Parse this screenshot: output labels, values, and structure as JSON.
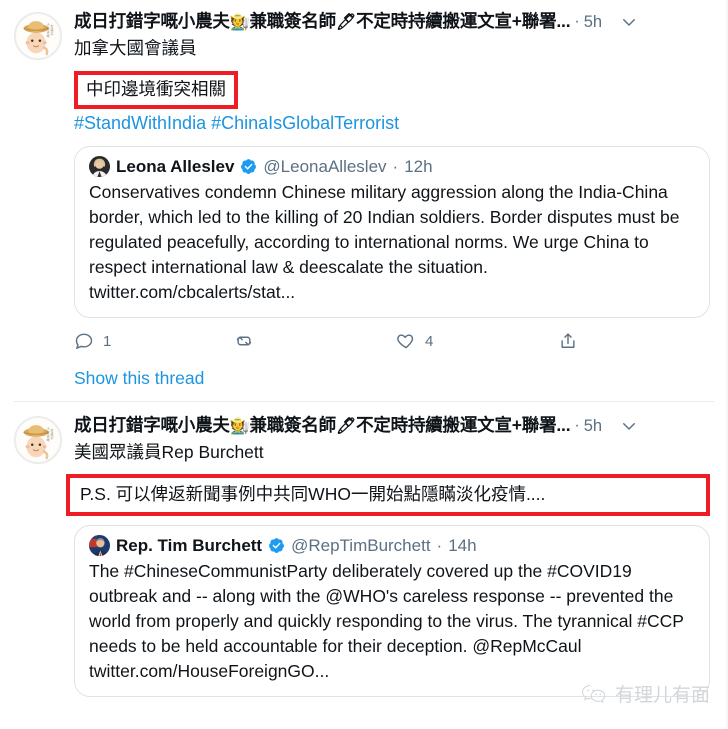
{
  "app": {
    "platform": "twitter-feed-screenshot"
  },
  "colors": {
    "link": "#1b95e0",
    "highlight_box": "#ee1c25",
    "verified_badge": "#1d9bf0",
    "meta_text": "#5b7083",
    "primary_text": "#0f1419",
    "card_border": "#dfe3e6",
    "watermark": "#d2d6da"
  },
  "tweets": [
    {
      "author": {
        "display_name_prefix": "成日打錯字嘅小農夫",
        "emoji_1": "🧑‍🌾",
        "display_name_mid": "兼職簽名師",
        "emoji_2": "🖊",
        "display_name_suffix": "不定時持續搬運文宣+聯署...",
        "avatar_icon": "cartoon-farmer-avatar"
      },
      "meta": {
        "dot": "·",
        "timestamp": "5h"
      },
      "caret_icon": "chevron-down-icon",
      "subtitle": "加拿大國會議員",
      "highlighted_text": "中印邊境衝突相關",
      "hashtags": "#StandWithIndia #ChinaIsGlobalTerrorist",
      "quote": {
        "avatar_icon": "leona-alleslev-avatar",
        "name": "Leona Alleslev",
        "verified_icon": "verified-badge-icon",
        "handle": "@LeonaAlleslev",
        "dot": "·",
        "timestamp": "12h",
        "text": "Conservatives condemn Chinese military aggression along the India-China border, which led to the killing of 20 Indian soldiers. Border disputes must be regulated peacefully, according to international norms. We urge China to respect international law & deescalate the situation. twitter.com/cbcalerts/stat..."
      },
      "actions": {
        "reply": {
          "icon": "reply-icon",
          "count": "1"
        },
        "retweet": {
          "icon": "retweet-icon",
          "count": ""
        },
        "like": {
          "icon": "heart-icon",
          "count": "4"
        },
        "share": {
          "icon": "share-icon",
          "count": ""
        }
      },
      "show_thread": "Show this thread"
    },
    {
      "author": {
        "display_name_prefix": "成日打錯字嘅小農夫",
        "emoji_1": "🧑‍🌾",
        "display_name_mid": "兼職簽名師",
        "emoji_2": "🖊",
        "display_name_suffix": "不定時持續搬運文宣+聯署...",
        "avatar_icon": "cartoon-farmer-avatar"
      },
      "meta": {
        "dot": "·",
        "timestamp": "5h"
      },
      "caret_icon": "chevron-down-icon",
      "subtitle": "美國眾議員Rep Burchett",
      "highlighted_text": "P.S. 可以俾返新聞事例中共同WHO一開始點隱瞞淡化疫情....",
      "quote": {
        "avatar_icon": "tim-burchett-avatar",
        "name": "Rep. Tim Burchett",
        "verified_icon": "verified-badge-icon",
        "handle": "@RepTimBurchett",
        "dot": "·",
        "timestamp": "14h",
        "text": "The #ChineseCommunistParty deliberately covered up the #COVID19 outbreak and -- along with the @WHO's careless response -- prevented the world from properly and quickly responding to the virus. The tyrannical #CCP needs to be held accountable for their deception. @RepMcCaul twitter.com/HouseForeignGO..."
      }
    }
  ],
  "watermark": {
    "icon": "wechat-logo-icon",
    "text": "有理儿有面"
  }
}
